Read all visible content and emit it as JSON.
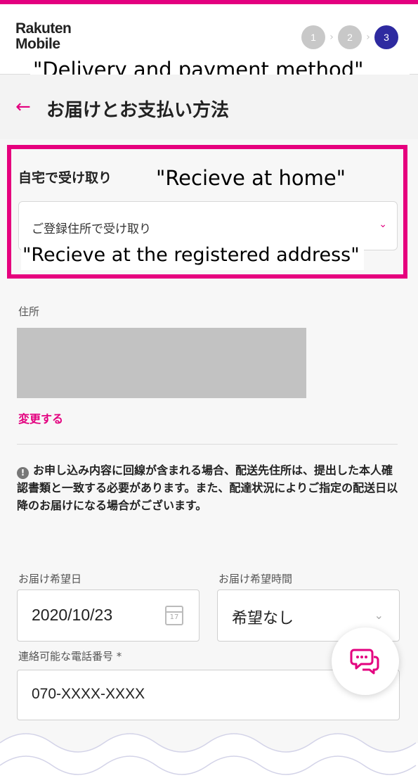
{
  "brand": {
    "logo_line1": "Rakuten",
    "logo_line2": "Mobile",
    "accent_color": "#e3007f"
  },
  "steps": {
    "items": [
      "1",
      "2",
      "3"
    ],
    "active": "3"
  },
  "annotations": {
    "header_caption": "\"Delivery and payment method\"",
    "receive_caption": "\"Recieve at home\"",
    "select_caption": "\"Recieve at the registered address\"",
    "highlight_color": "#e6007e"
  },
  "page": {
    "back_icon": "back-arrow-icon",
    "title": "お届けとお支払い方法"
  },
  "delivery": {
    "section_label": "自宅で受け取り",
    "select_value": "ご登録住所で受け取り",
    "address_label": "住所",
    "change_link": "変更する",
    "notice": "お申し込み内容に回線が含まれる場合、配送先住所は、提出した本人確認書類と一致する必要があります。また、配達状況によりご指定の配送日以降のお届けになる場合がございます。"
  },
  "form": {
    "date_label": "お届け希望日",
    "date_value": "2020/10/23",
    "calendar_day": "17",
    "time_label": "お届け希望時間",
    "time_value": "希望なし",
    "phone_label": "連絡可能な電話番号 *",
    "phone_value": "070-XXXX-XXXX"
  },
  "chat": {
    "icon": "chat-icon"
  }
}
